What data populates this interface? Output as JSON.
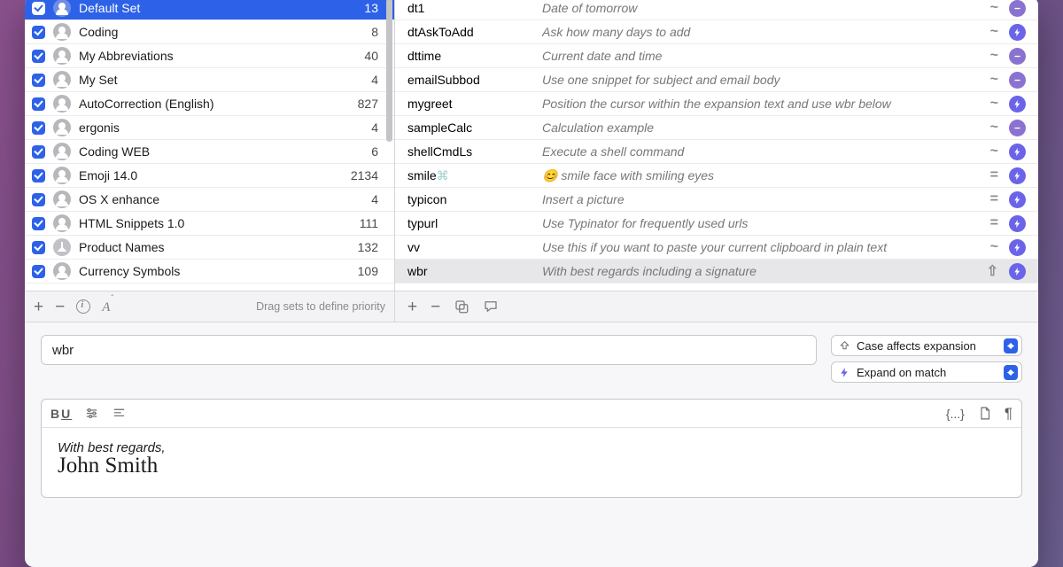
{
  "sidebar": {
    "footer_hint": "Drag sets to define priority",
    "sets": [
      {
        "name": "Default Set",
        "count": "13",
        "selected": true,
        "icon": "user"
      },
      {
        "name": "Coding",
        "count": "8",
        "icon": "user"
      },
      {
        "name": "My Abbreviations",
        "count": "40",
        "icon": "user"
      },
      {
        "name": "My Set",
        "count": "4",
        "icon": "user"
      },
      {
        "name": "AutoCorrection (English)",
        "count": "827",
        "icon": "user"
      },
      {
        "name": "ergonis",
        "count": "4",
        "icon": "user"
      },
      {
        "name": "Coding WEB",
        "count": "6",
        "icon": "user"
      },
      {
        "name": "Emoji 14.0",
        "count": "2134",
        "icon": "user"
      },
      {
        "name": "OS X enhance",
        "count": "4",
        "icon": "user"
      },
      {
        "name": "HTML Snippets 1.0",
        "count": "111",
        "icon": "user"
      },
      {
        "name": "Product Names",
        "count": "132",
        "icon": "download"
      },
      {
        "name": "Currency Symbols",
        "count": "109",
        "icon": "user"
      }
    ]
  },
  "snippets": [
    {
      "abbr": "dt1",
      "desc": "Date of tomorrow",
      "match": "~",
      "type": "purple"
    },
    {
      "abbr": "dtAskToAdd",
      "desc": "Ask how many days to add",
      "match": "~",
      "type": "bolt"
    },
    {
      "abbr": "dttime",
      "desc": "Current date and time",
      "match": "~",
      "type": "purple"
    },
    {
      "abbr": "emailSubbod",
      "desc": "Use one snippet for subject and email body",
      "match": "~",
      "type": "purple"
    },
    {
      "abbr": "mygreet",
      "desc": "Position the cursor within the expansion text and use wbr below",
      "match": "~",
      "type": "bolt"
    },
    {
      "abbr": "sampleCalc",
      "desc": "Calculation example",
      "match": "~",
      "type": "purple"
    },
    {
      "abbr": "shellCmdLs",
      "desc": "Execute a shell command",
      "match": "~",
      "type": "bolt"
    },
    {
      "abbr": "smile⌘",
      "desc": "😊 smile face with smiling eyes",
      "match": "=",
      "type": "bolt"
    },
    {
      "abbr": "typicon",
      "desc": "Insert a picture",
      "match": "=",
      "type": "bolt"
    },
    {
      "abbr": "typurl",
      "desc": "Use Typinator for frequently used urls",
      "match": "=",
      "type": "bolt"
    },
    {
      "abbr": "vv",
      "desc": "Use this if you want to paste your current clipboard in plain text",
      "match": "~",
      "type": "bolt"
    },
    {
      "abbr": "wbr",
      "desc": "With best regards including a signature",
      "match": "⇧",
      "type": "bolt",
      "selected": true
    }
  ],
  "editor": {
    "abbrev": "wbr",
    "case_popup": "Case affects expansion",
    "expand_popup": "Expand on match",
    "body_line1": "With best regards,",
    "body_line2": "John Smith"
  }
}
